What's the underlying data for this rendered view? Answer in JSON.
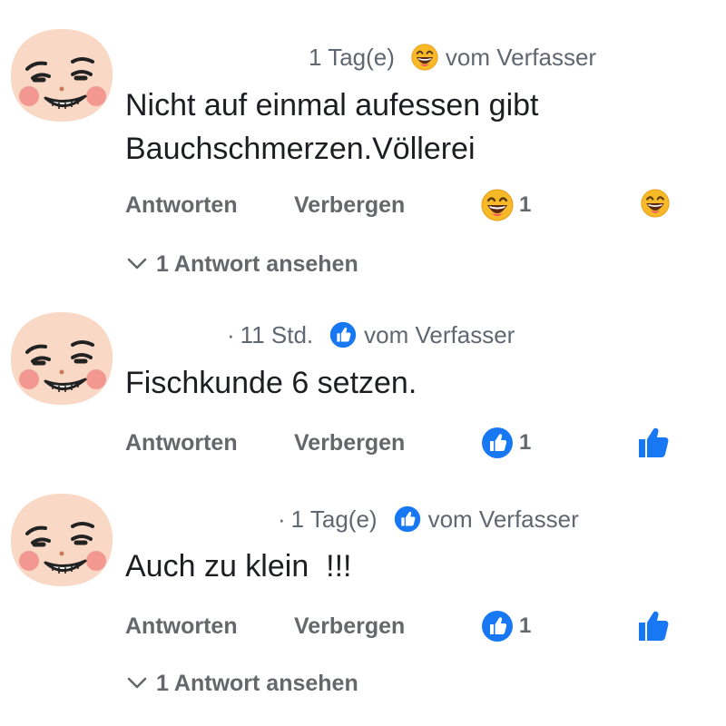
{
  "labels": {
    "reply": "Antworten",
    "hide": "Verbergen",
    "by_author": "vom Verfasser"
  },
  "icons": {
    "avatar": "cartoon-face-avatar-icon",
    "laugh": "laughing-emoji-icon",
    "like": "like-thumb-icon",
    "chevron": "chevron-down-icon"
  },
  "colors": {
    "like_blue": "#1877f2",
    "muted_text": "#65676b",
    "emoji_yellow": "#f7b928"
  },
  "comments": [
    {
      "time": "1 Tag(e)",
      "show_dot": false,
      "author_reaction": "laugh",
      "text_lines": [
        "Nicht auf einmal aufessen gibt",
        "Bauchschmerzen.Völlerei"
      ],
      "reaction_icon": "laugh",
      "reaction_count": "1",
      "my_reaction": "laugh",
      "replies_label": "1 Antwort ansehen"
    },
    {
      "time": "11 Std.",
      "show_dot": true,
      "author_reaction": "like",
      "text_lines": [
        "Fischkunde 6 setzen."
      ],
      "reaction_icon": "like",
      "reaction_count": "1",
      "my_reaction": "like",
      "replies_label": ""
    },
    {
      "time": "1 Tag(e)",
      "show_dot": true,
      "author_reaction": "like",
      "text_lines": [
        "Auch zu klein  !!!"
      ],
      "reaction_icon": "like",
      "reaction_count": "1",
      "my_reaction": "like",
      "replies_label": "1 Antwort ansehen"
    }
  ]
}
